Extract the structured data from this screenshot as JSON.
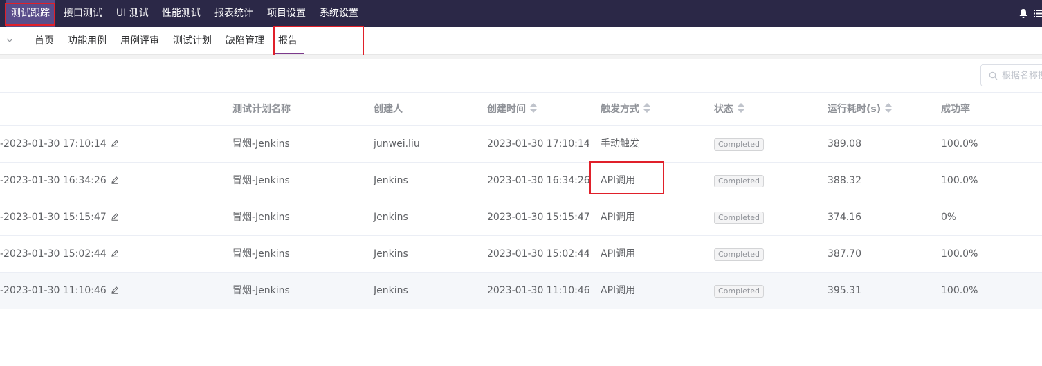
{
  "topnav": {
    "items": [
      "测试跟踪",
      "接口测试",
      "UI 测试",
      "性能测试",
      "报表统计",
      "项目设置",
      "系统设置"
    ],
    "active_index": 0
  },
  "subnav": {
    "items": [
      "首页",
      "功能用例",
      "用例评审",
      "测试计划",
      "缺陷管理",
      "报告"
    ],
    "active_index": 5
  },
  "search": {
    "placeholder": "根据名称搜索"
  },
  "table": {
    "columns": {
      "plan_name": "测试计划名称",
      "creator": "创建人",
      "create_time": "创建时间",
      "trigger_mode": "触发方式",
      "status": "状态",
      "duration": "运行耗时(s)",
      "success_rate": "成功率"
    },
    "rows": [
      {
        "name": "-2023-01-30 17:10:14",
        "plan_name": "冒烟-Jenkins",
        "creator": "junwei.liu",
        "create_time": "2023-01-30 17:10:14",
        "trigger_mode": "手动触发",
        "status": "Completed",
        "duration": "389.08",
        "success_rate": "100.0%"
      },
      {
        "name": "-2023-01-30 16:34:26",
        "plan_name": "冒烟-Jenkins",
        "creator": "Jenkins",
        "create_time": "2023-01-30 16:34:26",
        "trigger_mode": "API调用",
        "status": "Completed",
        "duration": "388.32",
        "success_rate": "100.0%"
      },
      {
        "name": "-2023-01-30 15:15:47",
        "plan_name": "冒烟-Jenkins",
        "creator": "Jenkins",
        "create_time": "2023-01-30 15:15:47",
        "trigger_mode": "API调用",
        "status": "Completed",
        "duration": "374.16",
        "success_rate": "0%"
      },
      {
        "name": "-2023-01-30 15:02:44",
        "plan_name": "冒烟-Jenkins",
        "creator": "Jenkins",
        "create_time": "2023-01-30 15:02:44",
        "trigger_mode": "API调用",
        "status": "Completed",
        "duration": "387.70",
        "success_rate": "100.0%"
      },
      {
        "name": "-2023-01-30 11:10:46",
        "plan_name": "冒烟-Jenkins",
        "creator": "Jenkins",
        "create_time": "2023-01-30 11:10:46",
        "trigger_mode": "API调用",
        "status": "Completed",
        "duration": "395.31",
        "success_rate": "100.0%"
      }
    ]
  },
  "colors": {
    "topbar_bg": "#2b2847",
    "topbar_active_bg": "#5a4d8a",
    "highlight_box": "#e0202a",
    "subnav_active_underline": "#7c3a8c"
  },
  "icons": {
    "notification": "bell-icon",
    "menu": "list-menu-icon",
    "collapse": "chevron-down-icon",
    "search": "search-icon",
    "edit": "edit-pencil-icon"
  }
}
